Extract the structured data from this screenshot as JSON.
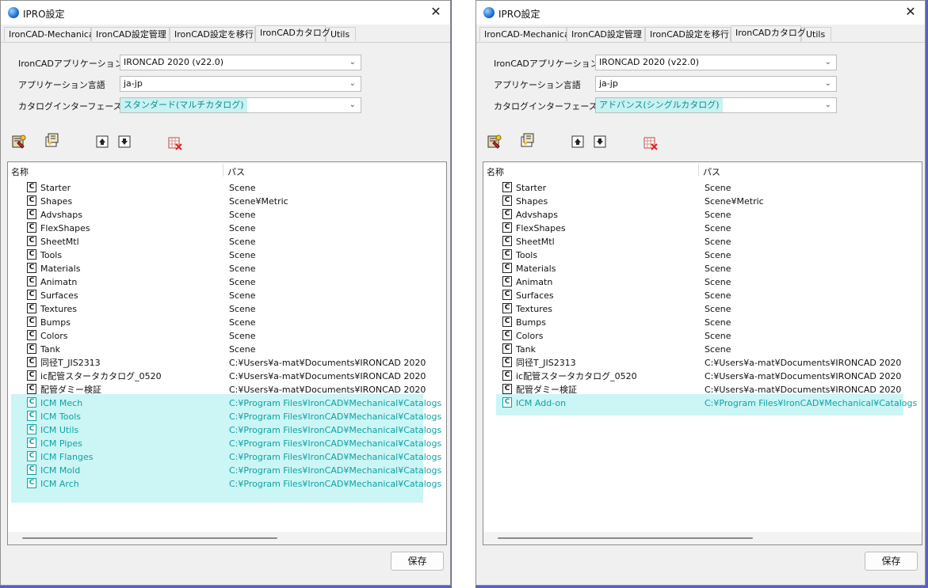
{
  "windows": [
    {
      "title": "IPRO設定",
      "tabs": [
        "IronCAD-Mechanical",
        "IronCAD設定管理",
        "IronCAD設定を移行",
        "IronCADカタログ",
        "Utils"
      ],
      "active_tab": 3,
      "fields": [
        {
          "label": "IronCADアプリケーション",
          "value": "IRONCAD 2020 (v22.0)"
        },
        {
          "label": "アプリケーション言語",
          "value": "ja-jp"
        },
        {
          "label": "カタログインターフェース",
          "value": "スタンダード(マルチカタログ)"
        }
      ],
      "list": {
        "headers": [
          "名称",
          "パス"
        ],
        "rows": [
          {
            "name": "Starter",
            "path": "Scene"
          },
          {
            "name": "Shapes",
            "path": "Scene¥Metric"
          },
          {
            "name": "Advshaps",
            "path": "Scene"
          },
          {
            "name": "FlexShapes",
            "path": "Scene"
          },
          {
            "name": "SheetMtl",
            "path": "Scene"
          },
          {
            "name": "Tools",
            "path": "Scene"
          },
          {
            "name": "Materials",
            "path": "Scene"
          },
          {
            "name": "Animatn",
            "path": "Scene"
          },
          {
            "name": "Surfaces",
            "path": "Scene"
          },
          {
            "name": "Textures",
            "path": "Scene"
          },
          {
            "name": "Bumps",
            "path": "Scene"
          },
          {
            "name": "Colors",
            "path": "Scene"
          },
          {
            "name": "Tank",
            "path": "Scene"
          },
          {
            "name": "同径T_JIS2313",
            "path": "C:¥Users¥a-mat¥Documents¥IRONCAD 2020"
          },
          {
            "name": "ic配管スタータカタログ_0520",
            "path": "C:¥Users¥a-mat¥Documents¥IRONCAD 2020"
          },
          {
            "name": "配管ダミー検証",
            "path": "C:¥Users¥a-mat¥Documents¥IRONCAD 2020"
          },
          {
            "name": "ICM Mech",
            "path": "C:¥Program Files¥IronCAD¥Mechanical¥Catalogs",
            "highlight": true
          },
          {
            "name": "ICM Tools",
            "path": "C:¥Program Files¥IronCAD¥Mechanical¥Catalogs",
            "highlight": true
          },
          {
            "name": "ICM Utils",
            "path": "C:¥Program Files¥IronCAD¥Mechanical¥Catalogs",
            "highlight": true
          },
          {
            "name": "ICM Pipes",
            "path": "C:¥Program Files¥IronCAD¥Mechanical¥Catalogs",
            "highlight": true
          },
          {
            "name": "ICM Flanges",
            "path": "C:¥Program Files¥IronCAD¥Mechanical¥Catalogs",
            "highlight": true
          },
          {
            "name": "ICM Mold",
            "path": "C:¥Program Files¥IronCAD¥Mechanical¥Catalogs",
            "highlight": true
          },
          {
            "name": "ICM Arch",
            "path": "C:¥Program Files¥IronCAD¥Mechanical¥Catalogs",
            "highlight": true
          }
        ]
      },
      "save_label": "保存"
    },
    {
      "title": "IPRO設定",
      "tabs": [
        "IronCAD-Mechanical",
        "IronCAD設定管理",
        "IronCAD設定を移行",
        "IronCADカタログ",
        "Utils"
      ],
      "active_tab": 3,
      "fields": [
        {
          "label": "IronCADアプリケーション",
          "value": "IRONCAD 2020 (v22.0)"
        },
        {
          "label": "アプリケーション言語",
          "value": "ja-jp"
        },
        {
          "label": "カタログインターフェース",
          "value": "アドバンス(シングルカタログ)"
        }
      ],
      "list": {
        "headers": [
          "名称",
          "パス"
        ],
        "rows": [
          {
            "name": "Starter",
            "path": "Scene"
          },
          {
            "name": "Shapes",
            "path": "Scene¥Metric"
          },
          {
            "name": "Advshaps",
            "path": "Scene"
          },
          {
            "name": "FlexShapes",
            "path": "Scene"
          },
          {
            "name": "SheetMtl",
            "path": "Scene"
          },
          {
            "name": "Tools",
            "path": "Scene"
          },
          {
            "name": "Materials",
            "path": "Scene"
          },
          {
            "name": "Animatn",
            "path": "Scene"
          },
          {
            "name": "Surfaces",
            "path": "Scene"
          },
          {
            "name": "Textures",
            "path": "Scene"
          },
          {
            "name": "Bumps",
            "path": "Scene"
          },
          {
            "name": "Colors",
            "path": "Scene"
          },
          {
            "name": "Tank",
            "path": "Scene"
          },
          {
            "name": "同径T_JIS2313",
            "path": "C:¥Users¥a-mat¥Documents¥IRONCAD 2020"
          },
          {
            "name": "ic配管スタータカタログ_0520",
            "path": "C:¥Users¥a-mat¥Documents¥IRONCAD 2020"
          },
          {
            "name": "配管ダミー検証",
            "path": "C:¥Users¥a-mat¥Documents¥IRONCAD 2020"
          },
          {
            "name": "ICM Add-on",
            "path": "C:¥Program Files¥IronCAD¥Mechanical¥Catalogs",
            "highlight": true
          }
        ]
      },
      "save_label": "保存"
    }
  ],
  "colors": {
    "highlight_bg": "#ccf5f5",
    "highlight_text": "#0ea3a3",
    "desktop": "#5a5fc4"
  },
  "icons": {
    "app": "globe-icon",
    "close": "close-icon",
    "toolbar": [
      "add-catalog-icon",
      "edit-catalog-icon",
      "move-up-icon",
      "move-down-icon",
      "delete-catalog-icon"
    ],
    "catalog_item": "catalog-c-icon"
  }
}
